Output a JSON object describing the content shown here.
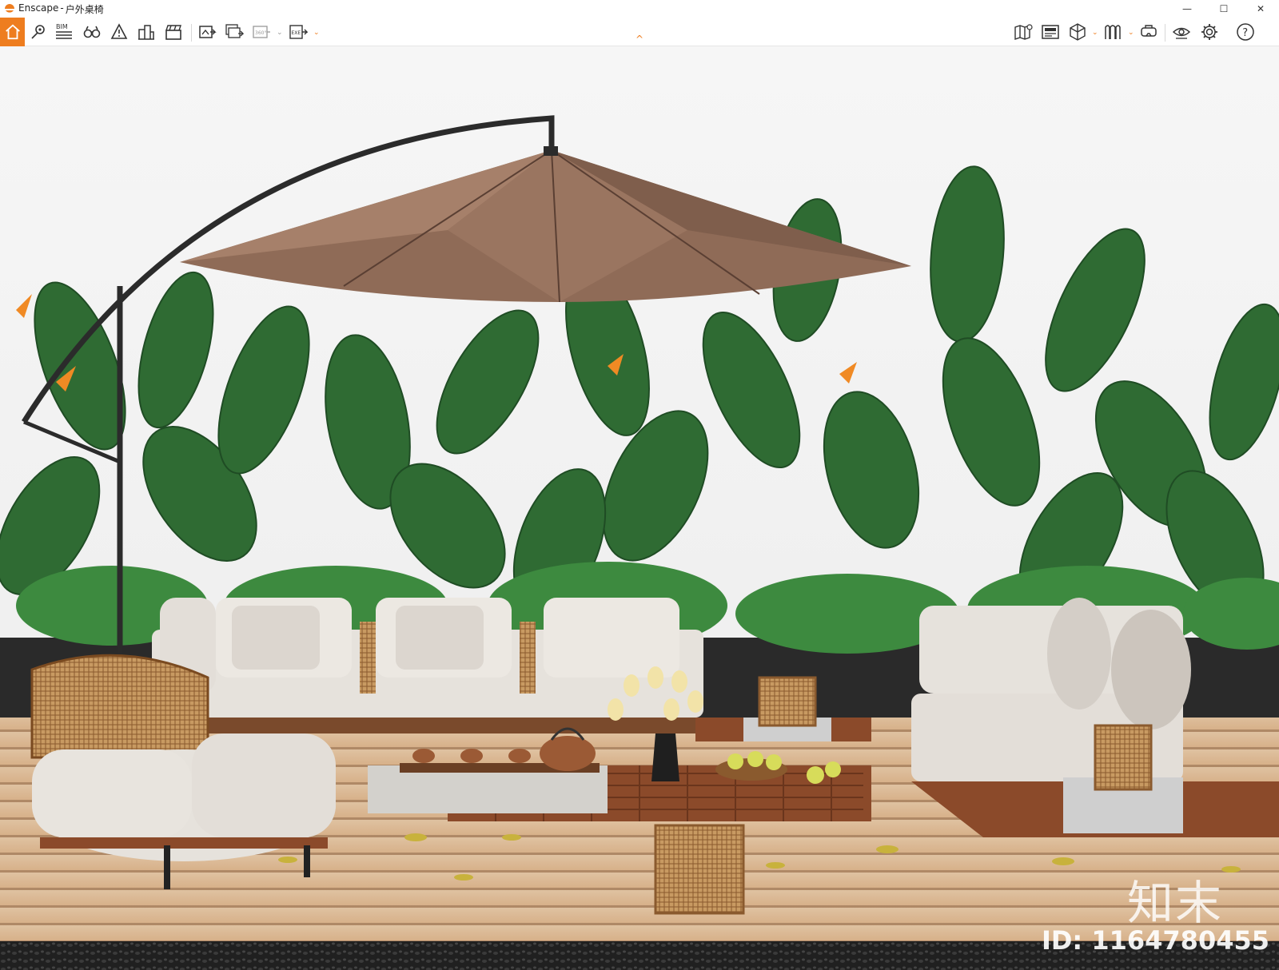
{
  "window": {
    "app_name": "Enscape",
    "separator": "-",
    "document_title": "户外桌椅",
    "controls": {
      "minimize": "—",
      "maximize": "☐",
      "close": "✕"
    }
  },
  "toolbar": {
    "left_tools": [
      {
        "name": "home-icon"
      },
      {
        "name": "map-pin-icon"
      },
      {
        "name": "bim-icon",
        "label": "BIM"
      },
      {
        "name": "binoculars-icon"
      },
      {
        "name": "warning-triangle-icon"
      },
      {
        "name": "buildings-icon"
      },
      {
        "name": "clapperboard-icon"
      },
      {
        "name": "render-image-icon"
      },
      {
        "name": "batch-render-icon"
      },
      {
        "name": "panorama-icon",
        "label": "360°"
      },
      {
        "name": "export-exe-icon",
        "label": "EXE"
      }
    ],
    "right_tools": [
      {
        "name": "map-info-icon"
      },
      {
        "name": "info-panel-icon"
      },
      {
        "name": "cube-icon"
      },
      {
        "name": "asset-library-icon"
      },
      {
        "name": "vr-headset-icon"
      },
      {
        "name": "visual-settings-eye-icon"
      },
      {
        "name": "settings-gear-icon"
      },
      {
        "name": "help-icon",
        "label": "?"
      }
    ],
    "collapse_glyph": "^"
  },
  "viewport": {
    "watermark_brand": "知末",
    "watermark_id": "ID: 1164780455",
    "colors": {
      "accent": "#ee7d1f",
      "background": "#f2f2f2",
      "umbrella": "#8f6b57",
      "leaf": "#2f6b33",
      "cushion": "#e6e2dc",
      "deck": "#d9b48c",
      "wood": "#8b4a2a"
    }
  }
}
